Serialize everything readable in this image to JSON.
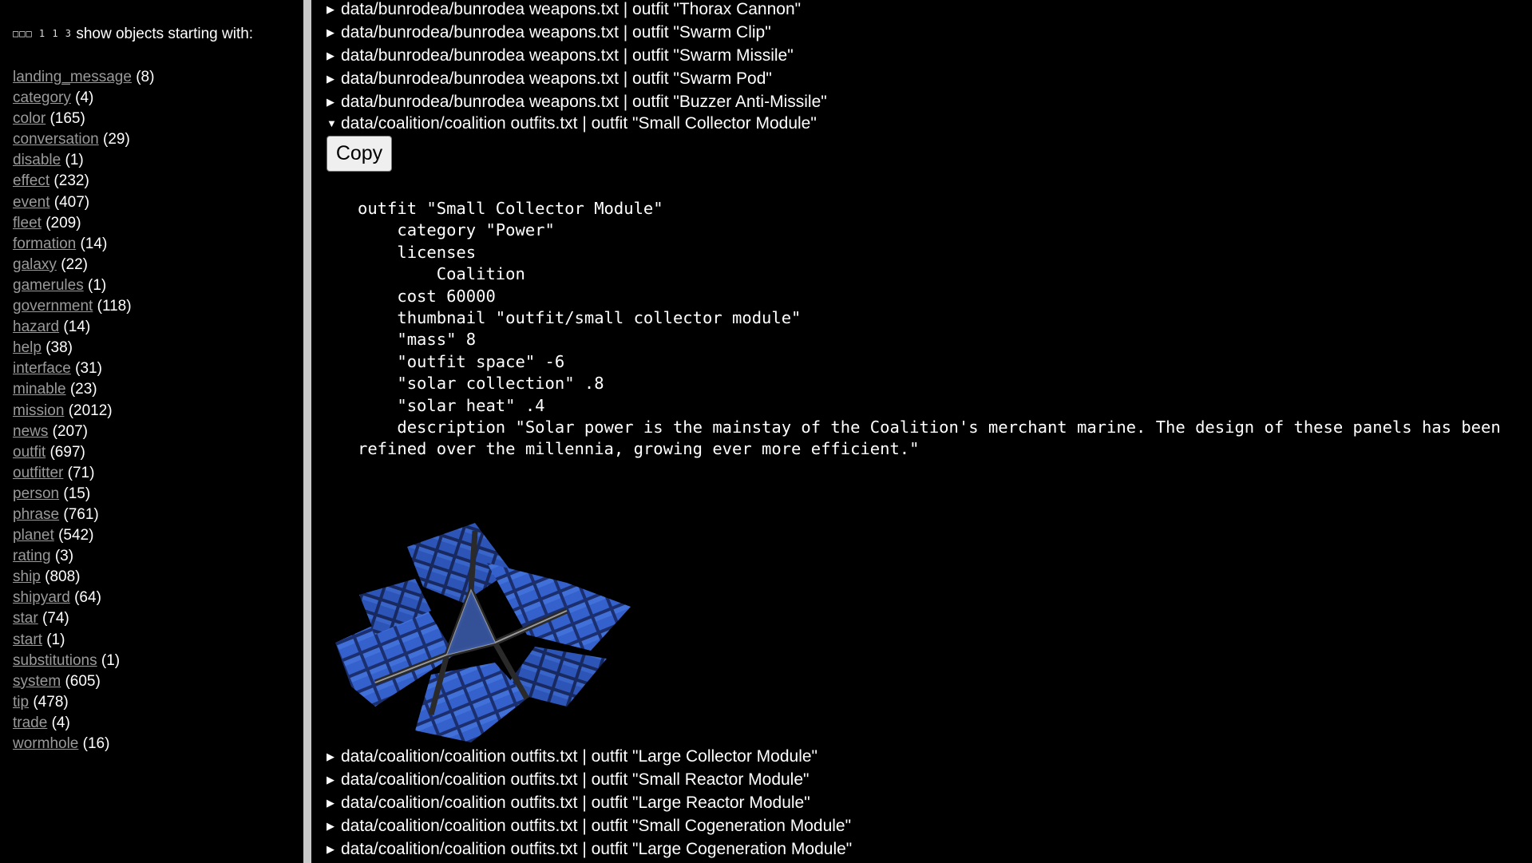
{
  "sidebar": {
    "filter_boxes": "□□□ 1 1 3",
    "filter_label": "show objects starting with:",
    "categories": [
      {
        "name": "landing_message",
        "count": "(8)"
      },
      {
        "name": "category",
        "count": "(4)"
      },
      {
        "name": "color",
        "count": "(165)"
      },
      {
        "name": "conversation",
        "count": "(29)"
      },
      {
        "name": "disable",
        "count": "(1)"
      },
      {
        "name": "effect",
        "count": "(232)"
      },
      {
        "name": "event",
        "count": "(407)"
      },
      {
        "name": "fleet",
        "count": "(209)"
      },
      {
        "name": "formation",
        "count": "(14)"
      },
      {
        "name": "galaxy",
        "count": "(22)"
      },
      {
        "name": "gamerules",
        "count": "(1)"
      },
      {
        "name": "government",
        "count": "(118)"
      },
      {
        "name": "hazard",
        "count": "(14)"
      },
      {
        "name": "help",
        "count": "(38)"
      },
      {
        "name": "interface",
        "count": "(31)"
      },
      {
        "name": "minable",
        "count": "(23)"
      },
      {
        "name": "mission",
        "count": "(2012)"
      },
      {
        "name": "news",
        "count": "(207)"
      },
      {
        "name": "outfit",
        "count": "(697)"
      },
      {
        "name": "outfitter",
        "count": "(71)"
      },
      {
        "name": "person",
        "count": "(15)"
      },
      {
        "name": "phrase",
        "count": "(761)"
      },
      {
        "name": "planet",
        "count": "(542)"
      },
      {
        "name": "rating",
        "count": "(3)"
      },
      {
        "name": "ship",
        "count": "(808)"
      },
      {
        "name": "shipyard",
        "count": "(64)"
      },
      {
        "name": "star",
        "count": "(74)"
      },
      {
        "name": "start",
        "count": "(1)"
      },
      {
        "name": "substitutions",
        "count": "(1)"
      },
      {
        "name": "system",
        "count": "(605)"
      },
      {
        "name": "tip",
        "count": "(478)"
      },
      {
        "name": "trade",
        "count": "(4)"
      },
      {
        "name": "wormhole",
        "count": "(16)"
      }
    ]
  },
  "main": {
    "entries_before": [
      {
        "marker": "▶",
        "text": "data/bunrodea/bunrodea weapons.txt | outfit \"Thorax Cannon\""
      },
      {
        "marker": "▶",
        "text": "data/bunrodea/bunrodea weapons.txt | outfit \"Swarm Clip\""
      },
      {
        "marker": "▶",
        "text": "data/bunrodea/bunrodea weapons.txt | outfit \"Swarm Missile\""
      },
      {
        "marker": "▶",
        "text": "data/bunrodea/bunrodea weapons.txt | outfit \"Swarm Pod\""
      },
      {
        "marker": "▶",
        "text": "data/bunrodea/bunrodea weapons.txt | outfit \"Buzzer Anti-Missile\""
      }
    ],
    "expanded_entry": {
      "marker": "▼",
      "text": "data/coalition/coalition outfits.txt | outfit \"Small Collector Module\"",
      "copy_label": "Copy",
      "code": "outfit \"Small Collector Module\"\n\tcategory \"Power\"\n\tlicenses\n\t\tCoalition\n\tcost 60000\n\tthumbnail \"outfit/small collector module\"\n\t\"mass\" 8\n\t\"outfit space\" -6\n\t\"solar collection\" .8\n\t\"solar heat\" .4\n\tdescription \"Solar power is the mainstay of the Coalition's merchant marine. The design of these panels has been refined over the millennia, growing ever more efficient.\""
    },
    "entries_after": [
      {
        "marker": "▶",
        "text": "data/coalition/coalition outfits.txt | outfit \"Large Collector Module\""
      },
      {
        "marker": "▶",
        "text": "data/coalition/coalition outfits.txt | outfit \"Small Reactor Module\""
      },
      {
        "marker": "▶",
        "text": "data/coalition/coalition outfits.txt | outfit \"Large Reactor Module\""
      },
      {
        "marker": "▶",
        "text": "data/coalition/coalition outfits.txt | outfit \"Small Cogeneration Module\""
      },
      {
        "marker": "▶",
        "text": "data/coalition/coalition outfits.txt | outfit \"Large Cogeneration Module\""
      }
    ]
  },
  "colors": {
    "background": "#000000",
    "text": "#ffffff",
    "link": "#9a9a9a",
    "divider": "#c8c8c8",
    "panel_blue": "#2d5cc8"
  },
  "icons": {
    "collapsed": "triangle-right-icon",
    "expanded": "triangle-down-icon",
    "thumbnail": "solar-collector-icon"
  }
}
